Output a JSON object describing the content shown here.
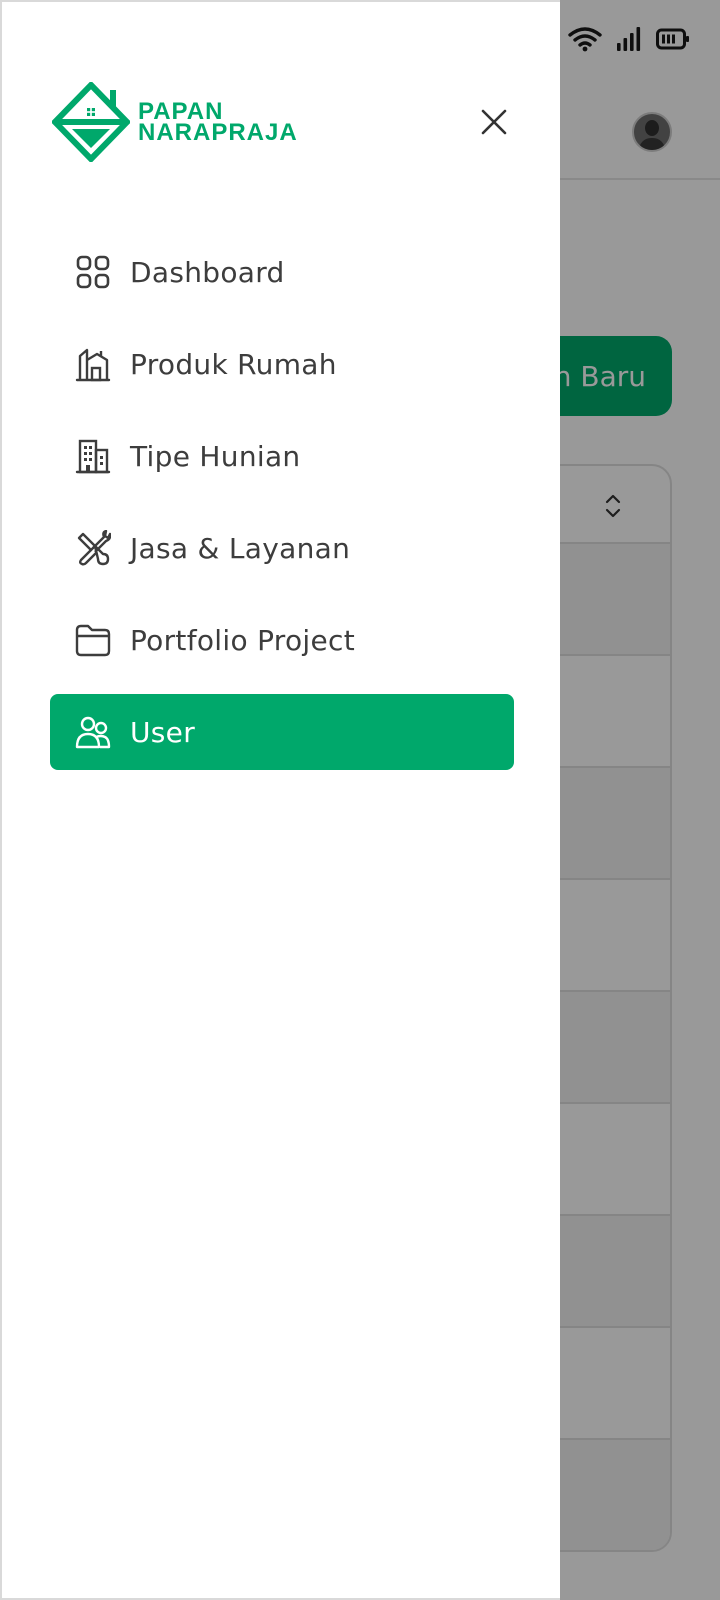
{
  "background": {
    "button_label": "n Baru",
    "table_rows": 9
  },
  "drawer": {
    "logo": {
      "line1": "PAPAN",
      "line2": "NARAPRAJA"
    },
    "close_icon": "close-icon",
    "menu": [
      {
        "label": "Dashboard",
        "icon": "grid-icon",
        "active": false
      },
      {
        "label": "Produk Rumah",
        "icon": "house-icon",
        "active": false
      },
      {
        "label": "Tipe Hunian",
        "icon": "building-icon",
        "active": false
      },
      {
        "label": "Jasa & Layanan",
        "icon": "tools-icon",
        "active": false
      },
      {
        "label": "Portfolio Project",
        "icon": "folder-icon",
        "active": false
      },
      {
        "label": "User",
        "icon": "users-icon",
        "active": true
      }
    ]
  },
  "colors": {
    "accent": "#00a86b",
    "text": "#3d3d3d"
  }
}
